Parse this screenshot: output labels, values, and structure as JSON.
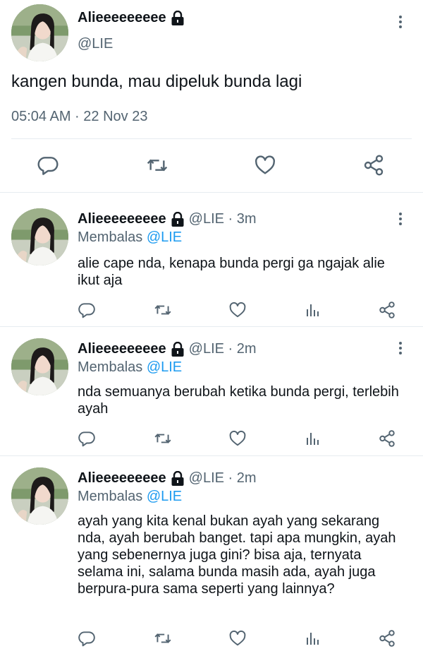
{
  "main_tweet": {
    "display_name": "Alieeeeeeeee",
    "handle": "@LIE",
    "text": "kangen bunda, mau dipeluk bunda lagi",
    "timestamp": "05:04 AM · 22 Nov 23",
    "actions": [
      "reply-icon",
      "retweet-icon",
      "like-icon",
      "share-icon"
    ]
  },
  "replies": [
    {
      "display_name": "Alieeeeeeeee",
      "handle_time": "@LIE · 3m",
      "replying_prefix": "Membalas ",
      "replying_to": "@LIE",
      "text": "alie cape nda, kenapa bunda pergi ga ngajak alie ikut aja"
    },
    {
      "display_name": "Alieeeeeeeee",
      "handle_time": "@LIE · 2m",
      "replying_prefix": "Membalas ",
      "replying_to": "@LIE",
      "text": "nda semuanya berubah ketika bunda pergi, terlebih ayah"
    },
    {
      "display_name": "Alieeeeeeeee",
      "handle_time": "@LIE · 2m",
      "replying_prefix": "Membalas ",
      "replying_to": "@LIE",
      "text": "ayah yang kita kenal bukan ayah yang sekarang nda, ayah berubah banget. tapi apa mungkin, ayah yang sebenernya juga gini? bisa aja, ternyata selama ini, salama bunda masih ada, ayah juga berpura-pura sama seperti yang lainnya?"
    }
  ],
  "colors": {
    "text": "#0f1419",
    "secondary": "#536471",
    "link": "#1d9bf0",
    "divider": "#e6ecf0"
  }
}
